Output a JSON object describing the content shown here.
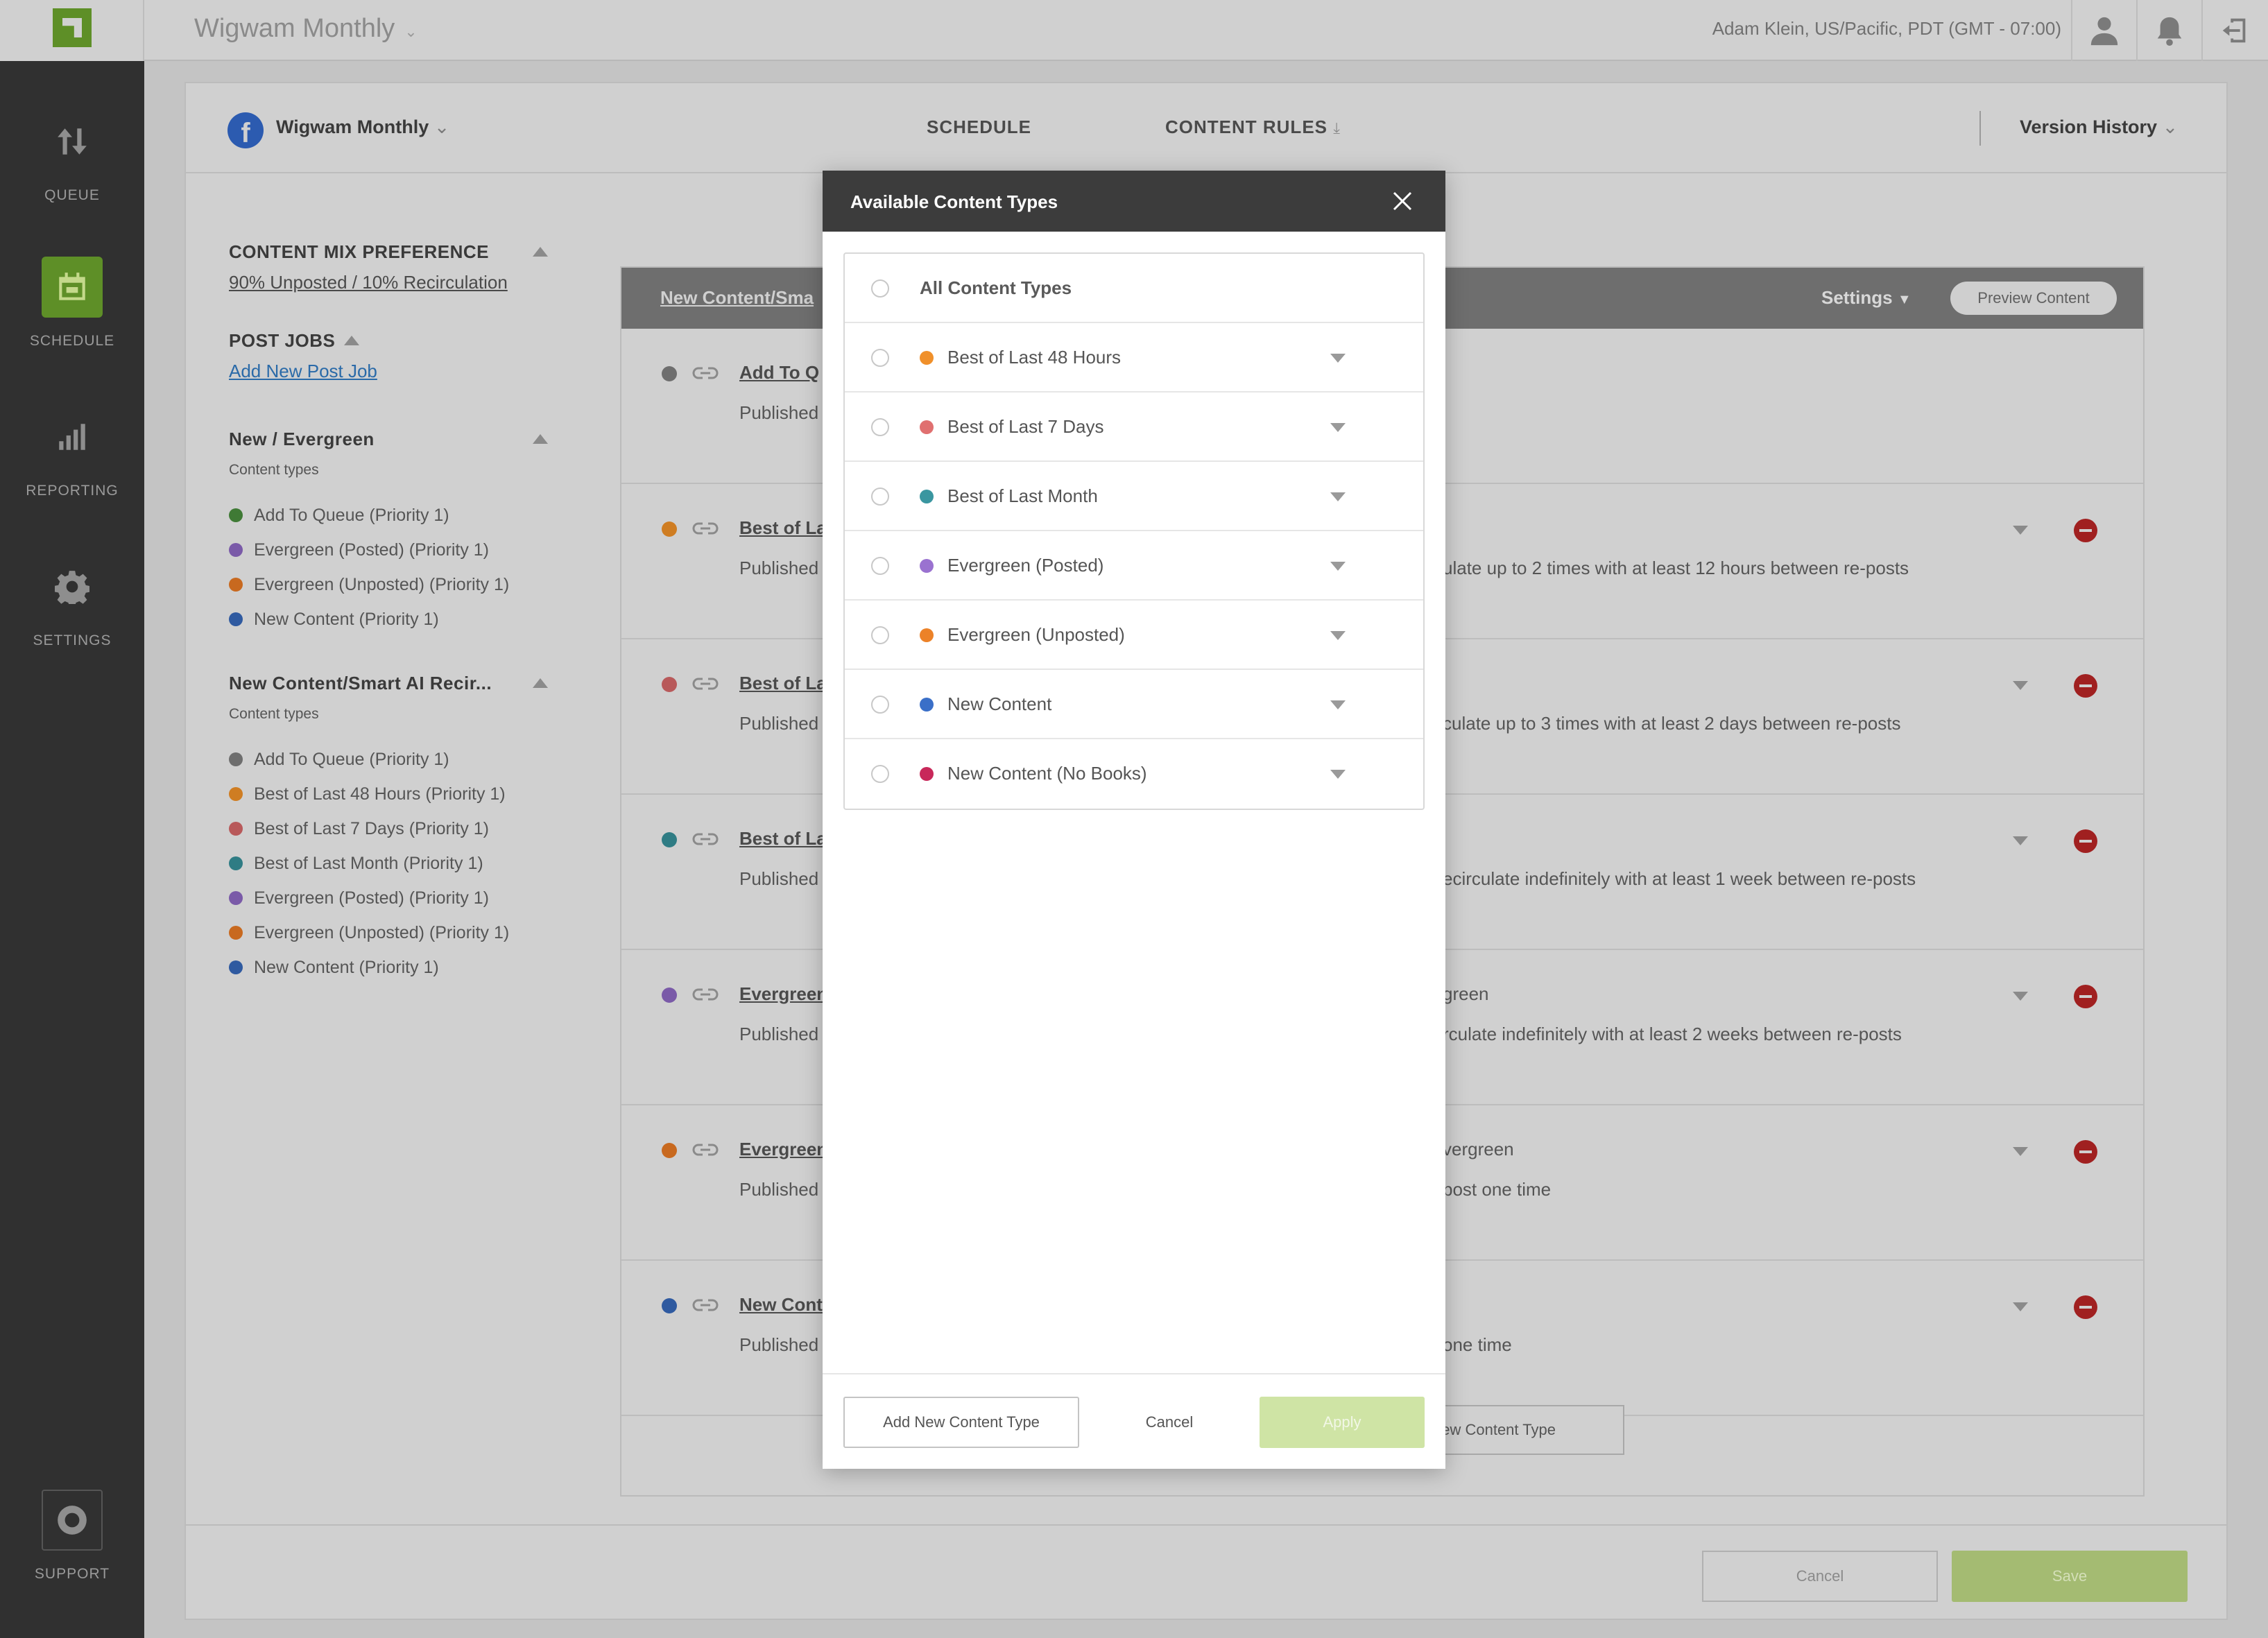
{
  "app": {
    "name": "Wigwam Monthly",
    "user_info": "Adam Klein, US/Pacific, PDT (GMT - 07:00)"
  },
  "topbar_icons": [
    "user-icon",
    "bell-icon",
    "logout-icon"
  ],
  "sidebar": {
    "items": [
      {
        "label": "QUEUE",
        "icon": "sort-arrows-icon"
      },
      {
        "label": "SCHEDULE",
        "icon": "calendar-icon",
        "active": true
      },
      {
        "label": "REPORTING",
        "icon": "bar-chart-icon"
      },
      {
        "label": "SETTINGS",
        "icon": "gear-icon"
      }
    ],
    "support": {
      "label": "SUPPORT",
      "icon": "lifebuoy-icon"
    }
  },
  "header": {
    "page_name": "Wigwam Monthly",
    "tabs": [
      {
        "label": "SCHEDULE"
      },
      {
        "label": "CONTENT RULES"
      }
    ],
    "version_history": "Version History"
  },
  "left_panel": {
    "mix_title": "CONTENT MIX PREFERENCE",
    "mix_value": "90% Unposted / 10% Recirculation",
    "post_jobs_title": "POST JOBS",
    "add_post_job": "Add New Post Job",
    "groups": [
      {
        "title": "New / Evergreen",
        "subtitle": "Content types",
        "items": [
          {
            "label": "Add To Queue (Priority 1)",
            "color": "#3f7a35"
          },
          {
            "label": "Evergreen (Posted) (Priority 1)",
            "color": "#7a5aa8"
          },
          {
            "label": "Evergreen (Unposted) (Priority 1)",
            "color": "#c8691f"
          },
          {
            "label": "New Content (Priority 1)",
            "color": "#2f5aa0"
          }
        ]
      },
      {
        "title": "New Content/Smart AI Recir...",
        "subtitle": "Content types",
        "items": [
          {
            "label": "Add To Queue (Priority 1)",
            "color": "#6e6e6e"
          },
          {
            "label": "Best of Last 48 Hours (Priority 1)",
            "color": "#cf7d22"
          },
          {
            "label": "Best of Last 7 Days (Priority 1)",
            "color": "#b8595a"
          },
          {
            "label": "Best of Last Month (Priority 1)",
            "color": "#2f7c84"
          },
          {
            "label": "Evergreen (Posted) (Priority 1)",
            "color": "#7a5aa8"
          },
          {
            "label": "Evergreen (Unposted) (Priority 1)",
            "color": "#c8691f"
          },
          {
            "label": "New Content (Priority 1)",
            "color": "#2f5aa0"
          }
        ]
      }
    ]
  },
  "table": {
    "title": "New Content/Sma",
    "settings_label": "Settings",
    "preview_label": "Preview Content",
    "rows": [
      {
        "title": "Add To Q",
        "published": "Published",
        "right1": "",
        "right2": "",
        "color": "#6e6e6e"
      },
      {
        "title": "Best of La",
        "published": "Published",
        "right1": "",
        "right2": "ulate up to 2 times with at least 12 hours between re-posts",
        "color": "#cf7d22"
      },
      {
        "title": "Best of La",
        "published": "Published",
        "right1": "",
        "right2": "culate up to 3 times with at least 2 days between re-posts",
        "color": "#b8595a"
      },
      {
        "title": "Best of La",
        "published": "Published",
        "right1": "",
        "right2": "ecirculate indefinitely with at least 1 week between re-posts",
        "color": "#2f7c84"
      },
      {
        "title": "Evergreen",
        "published": "Published",
        "right1": "green",
        "right2": "rculate indefinitely with at least 2 weeks between re-posts",
        "color": "#7a5aa8"
      },
      {
        "title": "Evergreen",
        "published": "Published",
        "right1": "vergreen",
        "right2": "post one time",
        "color": "#c8691f"
      },
      {
        "title": "New Cont",
        "published": "Published",
        "right1": "",
        "right2": "one time",
        "color": "#2f5aa0"
      }
    ],
    "add_content_type": "d New Content Type"
  },
  "footer": {
    "cancel": "Cancel",
    "save": "Save"
  },
  "modal": {
    "title": "Available Content Types",
    "all_label": "All Content Types",
    "options": [
      {
        "label": "Best of Last 48 Hours",
        "color": "#f0902a"
      },
      {
        "label": "Best of Last 7 Days",
        "color": "#e07070"
      },
      {
        "label": "Best of Last Month",
        "color": "#3a96a0"
      },
      {
        "label": "Evergreen (Posted)",
        "color": "#9a72d0"
      },
      {
        "label": "Evergreen (Unposted)",
        "color": "#ec8228"
      },
      {
        "label": "New Content",
        "color": "#3a6fc8"
      },
      {
        "label": "New Content (No Books)",
        "color": "#c8285a"
      }
    ],
    "add_new": "Add New Content Type",
    "cancel": "Cancel",
    "apply": "Apply"
  }
}
